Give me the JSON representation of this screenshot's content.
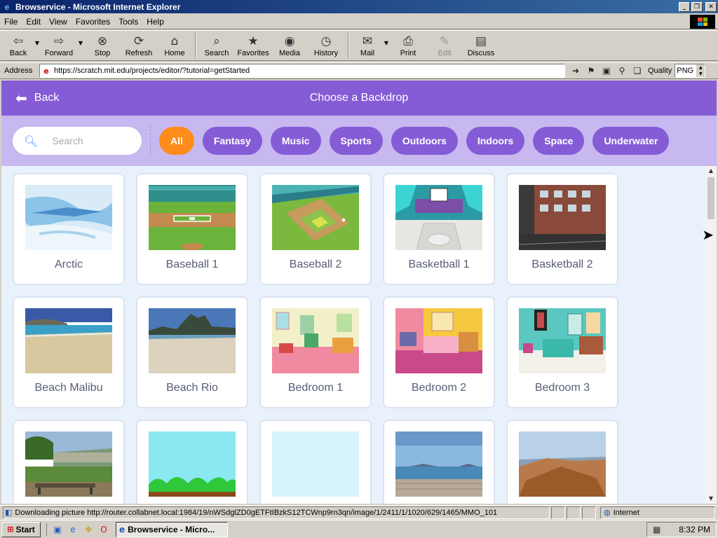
{
  "window": {
    "title": "Browservice - Microsoft Internet Explorer"
  },
  "menu": [
    "File",
    "Edit",
    "View",
    "Favorites",
    "Tools",
    "Help"
  ],
  "toolbar": {
    "back": "Back",
    "forward": "Forward",
    "stop": "Stop",
    "refresh": "Refresh",
    "home": "Home",
    "search": "Search",
    "favorites": "Favorites",
    "media": "Media",
    "history": "History",
    "mail": "Mail",
    "print": "Print",
    "edit": "Edit",
    "discuss": "Discuss"
  },
  "address": {
    "label": "Address",
    "url": "https://scratch.mit.edu/projects/editor/?tutorial=getStarted",
    "quality_label": "Quality",
    "quality_value": "PNG"
  },
  "scratch": {
    "back_label": "Back",
    "title": "Choose a Backdrop",
    "search_placeholder": "Search",
    "tags": [
      {
        "label": "All",
        "active": true
      },
      {
        "label": "Fantasy",
        "active": false
      },
      {
        "label": "Music",
        "active": false
      },
      {
        "label": "Sports",
        "active": false
      },
      {
        "label": "Outdoors",
        "active": false
      },
      {
        "label": "Indoors",
        "active": false
      },
      {
        "label": "Space",
        "active": false
      },
      {
        "label": "Underwater",
        "active": false
      }
    ],
    "backdrops": [
      {
        "name": "Arctic",
        "thumb": "arctic"
      },
      {
        "name": "Baseball 1",
        "thumb": "baseball1"
      },
      {
        "name": "Baseball 2",
        "thumb": "baseball2"
      },
      {
        "name": "Basketball 1",
        "thumb": "basketball1"
      },
      {
        "name": "Basketball 2",
        "thumb": "basketball2"
      },
      {
        "name": "Beach Malibu",
        "thumb": "beach-malibu"
      },
      {
        "name": "Beach Rio",
        "thumb": "beach-rio"
      },
      {
        "name": "Bedroom 1",
        "thumb": "bedroom1"
      },
      {
        "name": "Bedroom 2",
        "thumb": "bedroom2"
      },
      {
        "name": "Bedroom 3",
        "thumb": "bedroom3"
      },
      {
        "name": "",
        "thumb": "bench"
      },
      {
        "name": "",
        "thumb": "blue-sky"
      },
      {
        "name": "",
        "thumb": "light-blue"
      },
      {
        "name": "",
        "thumb": "boardwalk"
      },
      {
        "name": "",
        "thumb": "canyon"
      }
    ]
  },
  "status": {
    "text": "Downloading picture http://router.collabnet.local:1984/19/nWSdglZD0gETFtIBzkS12TCWnp9rn3qn/image/1/2411/1/1020/629/1465/MMO_101",
    "zone": "Internet"
  },
  "taskbar": {
    "start": "Start",
    "task": "Browservice - Micro...",
    "clock": "8:32 PM"
  },
  "colors": {
    "scratch_purple": "#855cd6",
    "tag_active": "#ff8c1a",
    "filter_bar": "#c7b8f0",
    "content_bg": "#e9f1fc"
  }
}
